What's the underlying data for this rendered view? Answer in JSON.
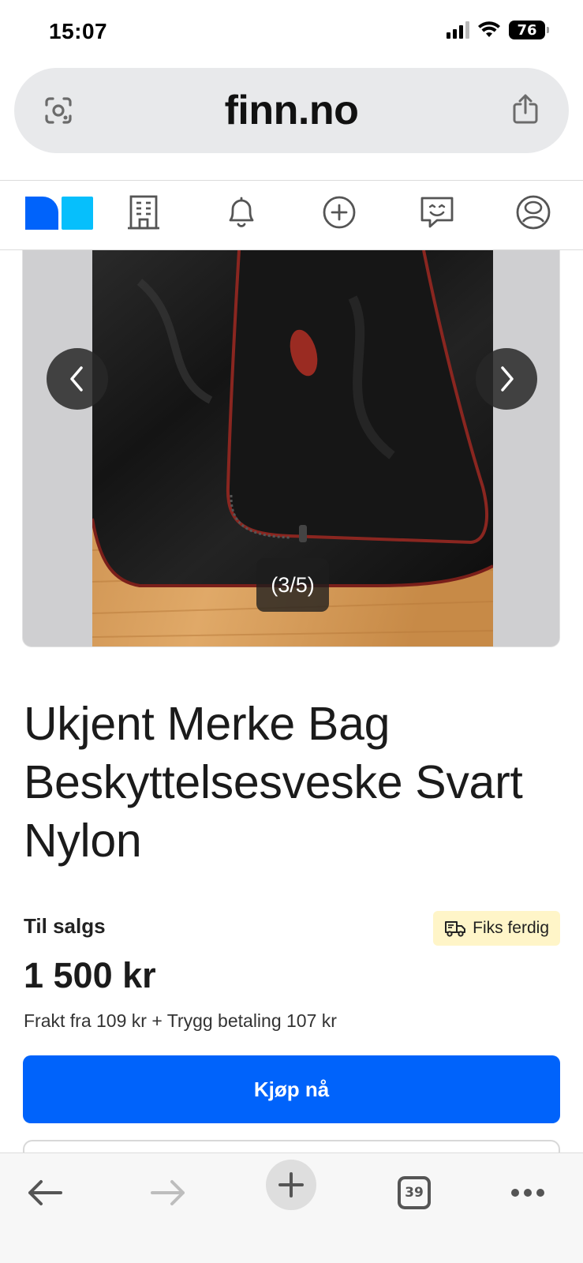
{
  "status_bar": {
    "time": "15:07",
    "battery": "76",
    "icons": [
      "signal-icon",
      "wifi-icon",
      "battery-icon"
    ]
  },
  "address_bar": {
    "url": "finn.no",
    "icons": [
      "lens-icon",
      "share-icon"
    ]
  },
  "finn_nav": {
    "logo_colors": [
      "#0063fb",
      "#06bffc"
    ],
    "items": [
      {
        "name": "finn-logo"
      },
      {
        "name": "company-building-icon"
      },
      {
        "name": "notifications-bell-icon"
      },
      {
        "name": "new-ad-plus-icon"
      },
      {
        "name": "messages-icon"
      },
      {
        "name": "profile-icon"
      }
    ]
  },
  "gallery": {
    "counter": "(3/5)",
    "prev_icon": "chevron-left-icon",
    "next_icon": "chevron-right-icon"
  },
  "listing": {
    "title": "Ukjent Merke Bag Beskyttelsesveske Svart Nylon",
    "sale_label": "Til salgs",
    "badge": "Fiks ferdig",
    "badge_icon": "delivery-truck-icon",
    "price": "1 500 kr",
    "shipping": "Frakt fra 109 kr + Trygg betaling 107 kr",
    "buy_button": "Kjøp nå",
    "accent_color": "#0063fb",
    "badge_color": "#fff5c8"
  },
  "toolbar": {
    "tabs_count": "39",
    "icons": [
      "back-arrow-icon",
      "forward-arrow-icon",
      "new-tab-plus-icon",
      "tabs-icon",
      "more-icon"
    ]
  }
}
